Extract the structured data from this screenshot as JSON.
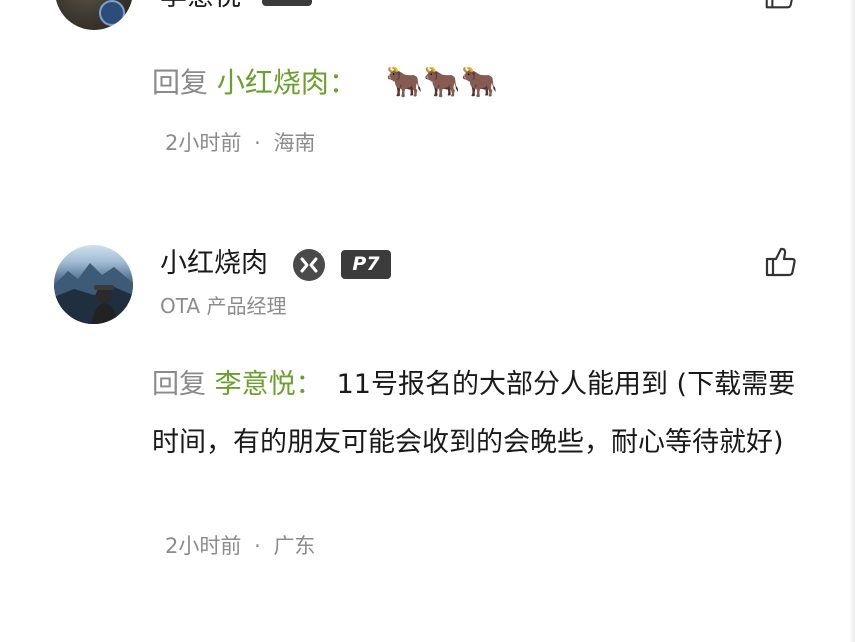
{
  "comment_top": {
    "username": "李意悦",
    "reply": {
      "prefix": "回复",
      "target": "小红烧肉",
      "colon": "：",
      "content": "🐂🐂🐂"
    },
    "time": "2小时前",
    "separator": "·",
    "location": "海南"
  },
  "comment_main": {
    "username": "小红烧肉",
    "level": "P7",
    "job_title": "OTA 产品经理",
    "reply": {
      "prefix": "回复",
      "target": "李意悦",
      "colon": "：",
      "content": "11号报名的大部分人能用到 (下载需要时间，有的朋友可能会收到的会晚些，耐心等待就好)"
    },
    "time": "2小时前",
    "separator": "·",
    "location": "广东"
  },
  "colors": {
    "accent_green": "#6b9f2e",
    "meta_gray": "#8c8c8c",
    "badge_dark": "#3b3b3b"
  },
  "icons": {
    "like": "thumbs-up-icon",
    "official": "x-badge-icon"
  }
}
